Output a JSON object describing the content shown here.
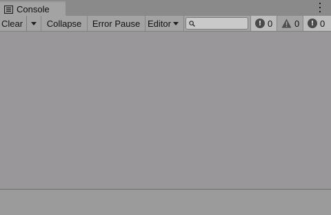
{
  "tab": {
    "title": "Console",
    "icon": "console-window-icon"
  },
  "menu": {
    "icon": "kebab-menu-icon"
  },
  "toolbar": {
    "clear_label": "Clear",
    "clear_dropdown_icon": "chevron-down-icon",
    "collapse_label": "Collapse",
    "error_pause_label": "Error Pause",
    "editor_label": "Editor",
    "editor_dropdown_icon": "chevron-down-icon",
    "search": {
      "icon": "search-icon",
      "value": "",
      "placeholder": ""
    },
    "counters": {
      "log": {
        "icon": "info-icon",
        "count": "0"
      },
      "warning": {
        "icon": "warning-icon",
        "count": "0"
      },
      "error": {
        "icon": "error-icon",
        "count": "0"
      }
    }
  },
  "colors": {
    "background": "#999799",
    "toolbar": "#a3a3a3",
    "tabbar": "#8b8a8b"
  }
}
